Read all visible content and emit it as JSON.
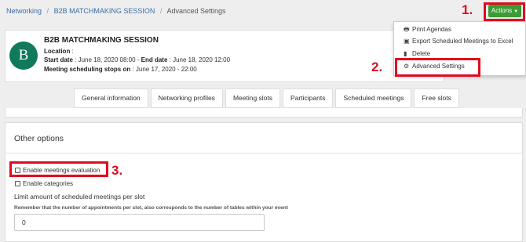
{
  "breadcrumb": {
    "items": [
      "Networking",
      "B2B MATCHMAKING SESSION",
      "Advanced Settings"
    ]
  },
  "actions": {
    "label": "Actions"
  },
  "session": {
    "initial": "B",
    "title": "B2B MATCHMAKING SESSION",
    "location_label": "Location",
    "location_value": "",
    "start_label": "Start date",
    "start_value": "June 18, 2020 08:00",
    "end_label": "End date",
    "end_value": "June 18, 2020 12:00",
    "stops_label": "Meeting scheduling stops on",
    "stops_value": "June 17, 2020 - 22:00"
  },
  "dropdown": {
    "items": [
      "Print Agendas",
      "Export Scheduled Meetings to Excel",
      "Delete",
      "Advanced Settings"
    ]
  },
  "tabs": [
    "General information",
    "Networking profiles",
    "Meeting slots",
    "Participants",
    "Scheduled meetings",
    "Free slots"
  ],
  "options": {
    "title": "Other options",
    "evaluation_label": "Enable meetings evaluation",
    "categories_label": "Enable categories",
    "limit_label": "Limit amount of scheduled meetings per slot",
    "note": "Remember that the number of appointments per slot, also corresponds to the number of tables within your event",
    "limit_value": "0"
  },
  "annotations": {
    "step1": "1.",
    "step2": "2.",
    "step3": "3."
  },
  "colors": {
    "actions_green": "#3c9b35",
    "highlight_red": "#e10a1e",
    "avatar_green": "#0f7a5c",
    "link_blue": "#3a6ea5"
  }
}
